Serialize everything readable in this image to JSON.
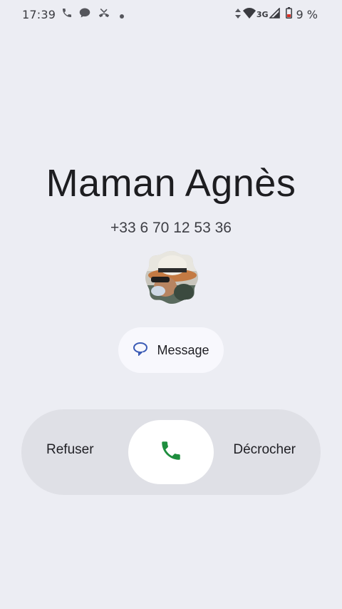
{
  "status_bar": {
    "time": "17:39",
    "network_type": "3G",
    "battery_percent": "9 %",
    "icons": [
      "phone-icon",
      "chat-bubble-icon",
      "missed-call-icon",
      "dot-icon",
      "data-arrows-icon",
      "wifi-icon",
      "signal-icon",
      "battery-icon"
    ]
  },
  "call": {
    "caller_name": "Maman Agnès",
    "caller_number": "+33 6 70 12 53 36"
  },
  "actions": {
    "message_label": "Message",
    "decline_label": "Refuser",
    "accept_label": "Décrocher"
  },
  "colors": {
    "background": "#ecedf3",
    "accept_green": "#1e8e3e",
    "message_icon": "#3b5bb5"
  }
}
